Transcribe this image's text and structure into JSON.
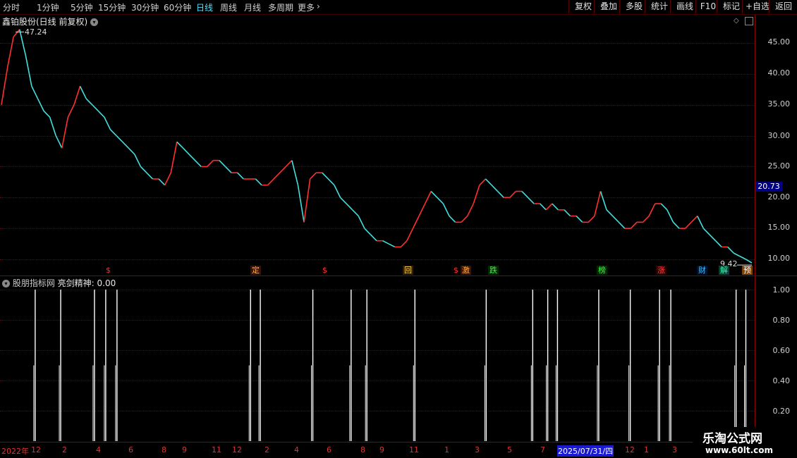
{
  "toolbar": {
    "periods": [
      "分时",
      "1分钟",
      "5分钟",
      "15分钟",
      "30分钟",
      "60分钟",
      "日线",
      "周线",
      "月线",
      "多周期",
      "更多"
    ],
    "active_period": "日线",
    "more_arrow": "›",
    "buttons": [
      "复权",
      "叠加",
      "多股",
      "统计",
      "画线",
      "F10",
      "标记",
      "+自选",
      "返回"
    ]
  },
  "main_chart": {
    "title": "鑫铂股份(日线 前复权)",
    "high_label": "47.24",
    "low_label": "9.42",
    "current_price": "20.73",
    "y_ticks": [
      "45.00",
      "40.00",
      "35.00",
      "30.00",
      "25.00",
      "20.00",
      "15.00",
      "10.00"
    ],
    "signals": [
      {
        "text": "$",
        "color": "#ff3030",
        "bg": "#000"
      },
      {
        "text": "定",
        "color": "#ffb040",
        "bg": "#401000"
      },
      {
        "text": "$",
        "color": "#ff3030",
        "bg": "#000"
      },
      {
        "text": "回",
        "color": "#ffd040",
        "bg": "#302000"
      },
      {
        "text": "$",
        "color": "#ff3030",
        "bg": "#000"
      },
      {
        "text": "激",
        "color": "#ffb040",
        "bg": "#401000"
      },
      {
        "text": "跌",
        "color": "#30ff30",
        "bg": "#002a00"
      },
      {
        "text": "榜",
        "color": "#30ff30",
        "bg": "#002a00"
      },
      {
        "text": "涨",
        "color": "#ff4040",
        "bg": "#300000"
      },
      {
        "text": "财",
        "color": "#40c0ff",
        "bg": "#001030"
      },
      {
        "text": "解",
        "color": "#30ff90",
        "bg": "#004040"
      },
      {
        "text": "预",
        "color": "#ffffff",
        "bg": "#804000"
      }
    ]
  },
  "indicator": {
    "source": "股朋指标网",
    "name": "亮剑精神:",
    "value": "0.00",
    "y_ticks": [
      "1.00",
      "0.80",
      "0.60",
      "0.40",
      "0.20"
    ]
  },
  "x_axis": {
    "labels": [
      "2022年",
      "12",
      "2",
      "4",
      "6",
      "8",
      "9",
      "11",
      "12",
      "2",
      "4",
      "6",
      "8",
      "9",
      "11",
      "1",
      "3",
      "5",
      "7",
      "2025/07/31/四",
      "12",
      "1",
      "3"
    ]
  },
  "watermark": {
    "name": "乐淘公式网",
    "url": "www.60lt.com"
  },
  "chart_data": {
    "type": "line",
    "title": "鑫铂股份(日线 前复权)",
    "y_range": [
      9,
      48
    ],
    "close": [
      35,
      41,
      46,
      47.2,
      43,
      38,
      36,
      34,
      33,
      30,
      28,
      33,
      35,
      38,
      36,
      35,
      34,
      33,
      31,
      30,
      29,
      28,
      27,
      25,
      24,
      23,
      23,
      22,
      24,
      29,
      28,
      27,
      26,
      25,
      25,
      26,
      26,
      25,
      24,
      24,
      23,
      23,
      23,
      22,
      22,
      23,
      24,
      25,
      26,
      22,
      16,
      23,
      24,
      24,
      23,
      22,
      20,
      19,
      18,
      17,
      15,
      14,
      13,
      13,
      12.5,
      12,
      12,
      13,
      15,
      17,
      19,
      21,
      20,
      19,
      17,
      16,
      16,
      17,
      19,
      22,
      23,
      22,
      21,
      20,
      20,
      21,
      21,
      20,
      19,
      19,
      18,
      19,
      18,
      18,
      17,
      17,
      16,
      16,
      17,
      21,
      18,
      17,
      16,
      15,
      15,
      16,
      16,
      17,
      19,
      19,
      18,
      16,
      15,
      15,
      16,
      17,
      15,
      14,
      13,
      12,
      12,
      11,
      10.5,
      10,
      9.42
    ],
    "indicator_series": [
      {
        "name": "亮剑精神",
        "signals": [
          0.045,
          0.079,
          0.124,
          0.139,
          0.154,
          0.332,
          0.345,
          0.415,
          0.466,
          0.487,
          0.551,
          0.646,
          0.708,
          0.728,
          0.741,
          0.796,
          0.838,
          0.877,
          0.892,
          0.979,
          0.992
        ],
        "ylim": [
          0,
          1.1
        ]
      }
    ]
  }
}
